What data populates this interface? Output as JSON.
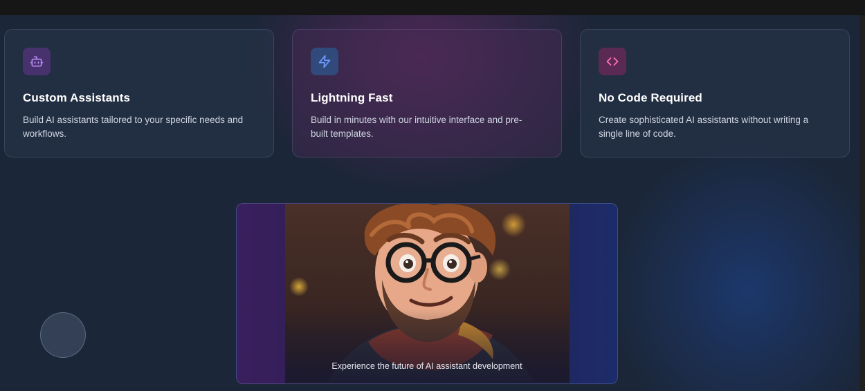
{
  "features": [
    {
      "icon": "bot-icon",
      "title": "Custom Assistants",
      "description": "Build AI assistants tailored to your specific needs and workflows."
    },
    {
      "icon": "lightning-icon",
      "title": "Lightning Fast",
      "description": "Build in minutes with our intuitive interface and pre-built templates."
    },
    {
      "icon": "code-icon",
      "title": "No Code Required",
      "description": "Create sophisticated AI assistants without writing a single line of code."
    }
  ],
  "media": {
    "image": "cartoon-man-with-glasses-portrait",
    "caption": "Experience the future of AI assistant development"
  },
  "colors": {
    "background": "#1b2638",
    "card_bg": "#28344a",
    "bot_icon": "#b98cf5",
    "lightning_icon": "#6f9cff",
    "code_icon": "#ff6fb5"
  }
}
